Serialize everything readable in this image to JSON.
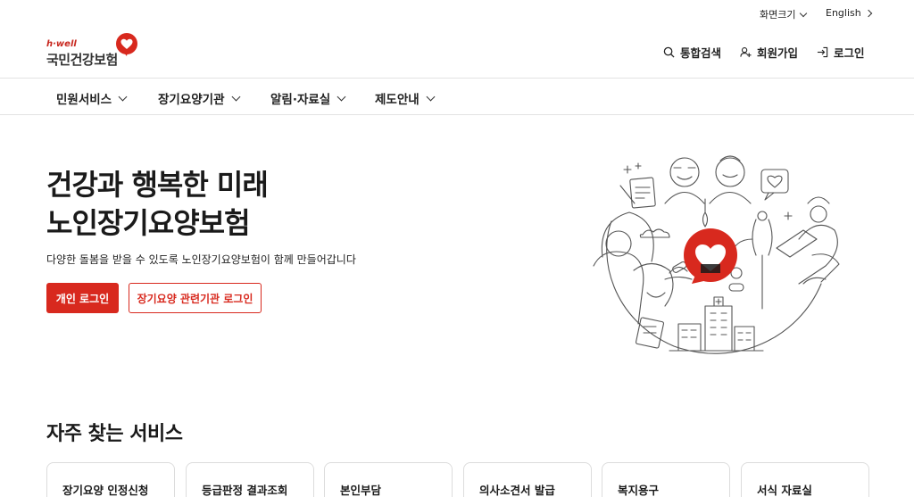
{
  "utility": {
    "screen_size_label": "화면크기",
    "language_label": "English"
  },
  "header": {
    "logo_sub": "h·well",
    "logo_main": "국민건강보험",
    "search_label": "통합검색",
    "join_label": "회원가입",
    "login_label": "로그인"
  },
  "gnb": {
    "items": [
      {
        "label": "민원서비스"
      },
      {
        "label": "장기요양기관"
      },
      {
        "label": "알림·자료실"
      },
      {
        "label": "제도안내"
      }
    ]
  },
  "hero": {
    "title_line1": "건강과 행복한 미래",
    "title_line2": "노인장기요양보험",
    "description": "다양한 돌봄을 받을 수 있도록 노인장기요양보험이 함께 만들어갑니다",
    "personal_login_label": "개인 로그인",
    "institution_login_label": "장기요양 관련기관 로그인"
  },
  "services": {
    "title": "자주 찾는 서비스",
    "items": [
      {
        "label": "장기요양 인정신청"
      },
      {
        "label": "등급판정 결과조회"
      },
      {
        "label": "본인부담"
      },
      {
        "label": "의사소견서 발급"
      },
      {
        "label": "복지용구"
      },
      {
        "label": "서식 자료실"
      }
    ]
  },
  "colors": {
    "brand_red": "#d8291e",
    "text_dark": "#1a1a1a",
    "border_gray": "#dcdcdc"
  },
  "icons": [
    "search-icon",
    "user-plus-icon",
    "login-icon",
    "heart-logo-icon",
    "chevron-down-icon",
    "chevron-right-icon"
  ]
}
